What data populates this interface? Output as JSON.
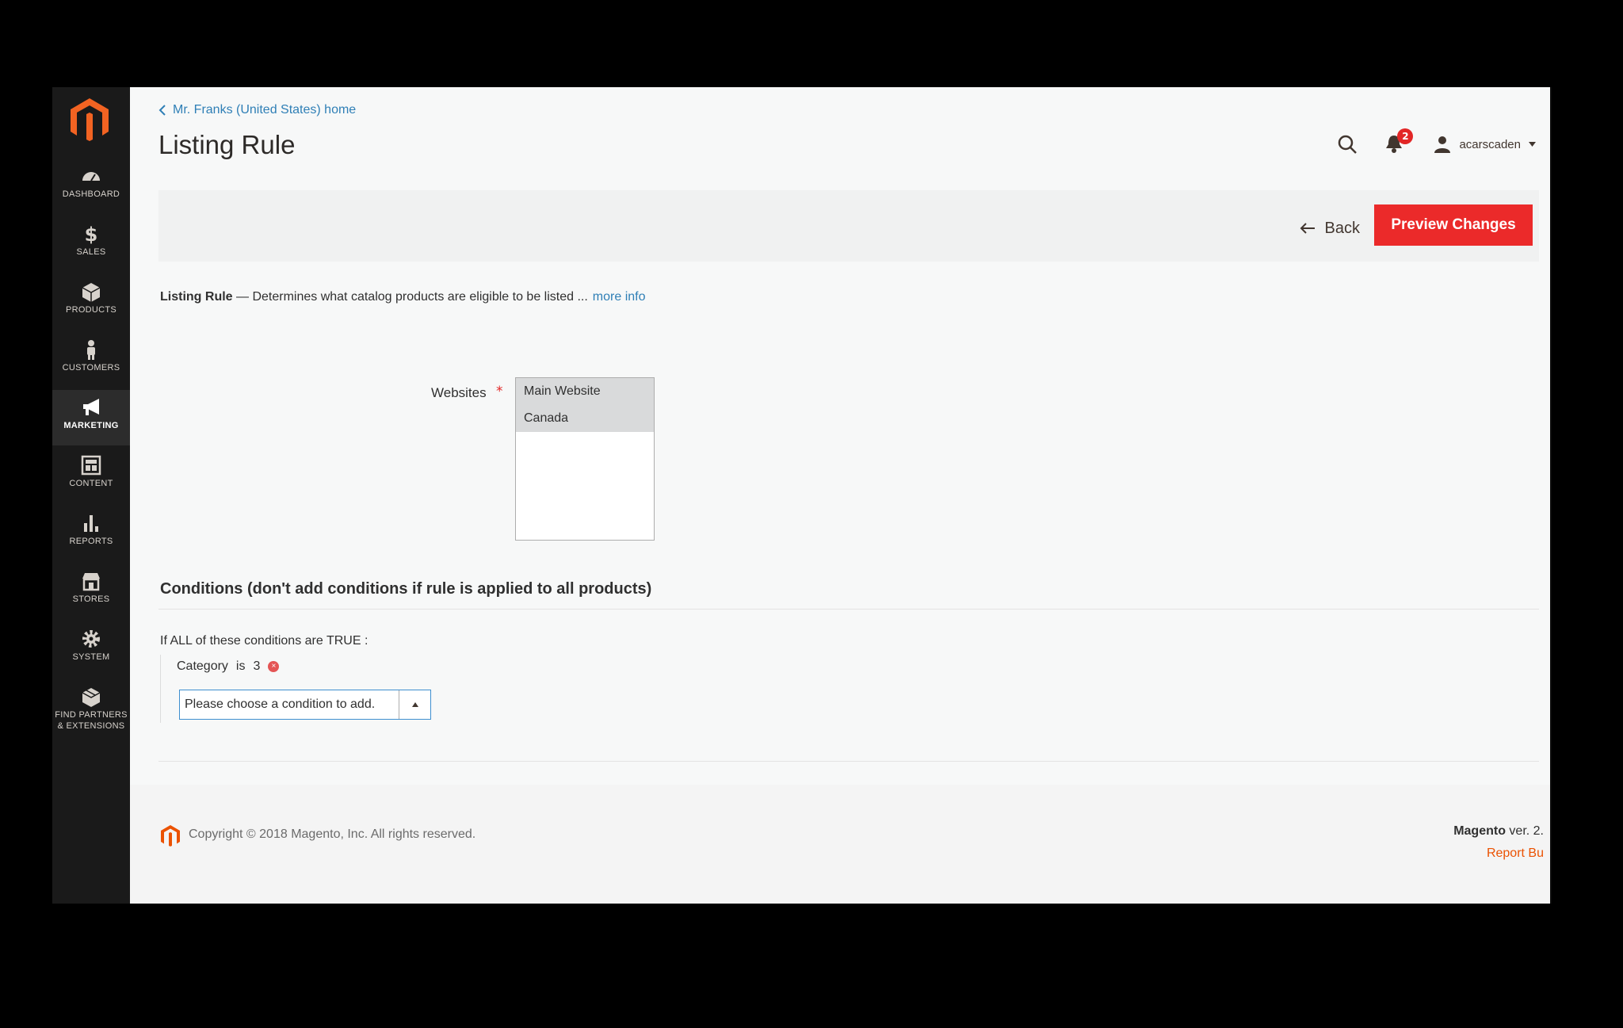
{
  "sidebar": {
    "items": [
      {
        "label": "DASHBOARD",
        "icon": "dashboard-icon"
      },
      {
        "label": "SALES",
        "icon": "dollar-icon"
      },
      {
        "label": "PRODUCTS",
        "icon": "cube-icon"
      },
      {
        "label": "CUSTOMERS",
        "icon": "person-icon"
      },
      {
        "label": "MARKETING",
        "icon": "megaphone-icon",
        "active": true
      },
      {
        "label": "CONTENT",
        "icon": "layout-icon"
      },
      {
        "label": "REPORTS",
        "icon": "bar-chart-icon"
      },
      {
        "label": "STORES",
        "icon": "storefront-icon"
      },
      {
        "label": "SYSTEM",
        "icon": "gear-icon"
      },
      {
        "label": "FIND PARTNERS",
        "label2": "& EXTENSIONS",
        "icon": "box-icon"
      }
    ]
  },
  "header": {
    "breadcrumb": "Mr. Franks (United States) home",
    "title": "Listing Rule",
    "notifications_count": "2",
    "username": "acarscaden"
  },
  "actions": {
    "back_label": "Back",
    "preview_label": "Preview Changes"
  },
  "description": {
    "title": "Listing Rule",
    "separator": " — ",
    "text": "Determines what catalog products are eligible to be listed ...",
    "link": "more info"
  },
  "websites": {
    "label": "Websites",
    "required_mark": "*",
    "options": [
      "Main Website",
      "Canada"
    ]
  },
  "conditions": {
    "title": "Conditions (don't add conditions if rule is applied to all products)",
    "intro_prefix": "If",
    "intro_aggregator": "ALL",
    "intro_mid": "of these conditions are",
    "intro_value": "TRUE",
    "intro_suffix": ":",
    "rule_attribute": "Category",
    "rule_operator": "is",
    "rule_value": "3",
    "add_placeholder": "Please choose a condition to add."
  },
  "footer": {
    "copyright": "Copyright © 2018 Magento, Inc. All rights reserved.",
    "version_brand": "Magento",
    "version_text": "ver. 2.",
    "report_link": "Report Bu"
  },
  "colors": {
    "accent": "#eb2a2a",
    "link": "#2f7fb6",
    "sidebar_bg": "#1a1a1a"
  }
}
